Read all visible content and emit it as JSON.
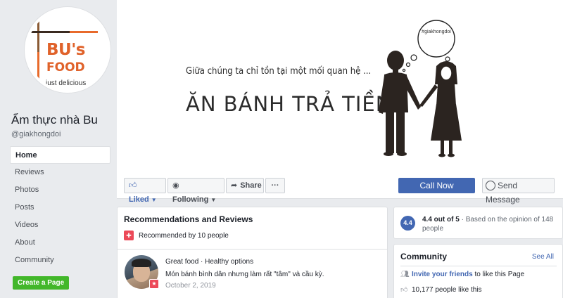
{
  "logo": {
    "line1": "BU's",
    "line2": "FOOD",
    "line3": "just delicious"
  },
  "page": {
    "name": "Ẩm thực nhà Bu",
    "handle": "@giakhongdoi"
  },
  "nav": [
    "Home",
    "Reviews",
    "Photos",
    "Posts",
    "Videos",
    "About",
    "Community"
  ],
  "create_page": "Create a Page",
  "cover": {
    "tagline": "Giữa chúng ta chỉ tồn tại một mối quan hệ ...",
    "headline": "ĂN BÁNH TRẢ TIỀN!!",
    "bubble_tag": "#giakhongdoi"
  },
  "actions": {
    "liked": "Liked",
    "following": "Following",
    "share": "Share",
    "more": "···",
    "call": "Call Now",
    "message": "Send Message"
  },
  "reviews": {
    "title": "Recommendations and Reviews",
    "recommended": "Recommended by 10 people",
    "review": {
      "tags": "Great food · Healthy options",
      "body": "Món bánh bình dân nhưng làm rất \"tâm\" và cầu kỳ.",
      "date": "October 2, 2019"
    }
  },
  "rating": {
    "score": "4.4",
    "summary": "4.4 out of 5",
    "basis": "Based on the opinion of 148 people"
  },
  "community": {
    "title": "Community",
    "see_all": "See All",
    "invite_link": "Invite your friends",
    "invite_rest": "to like this Page",
    "likes": "10,177 people like this"
  },
  "colors": {
    "fb_blue": "#4267b2",
    "brand_orange": "#e0622a",
    "create_green": "#42b72a"
  }
}
